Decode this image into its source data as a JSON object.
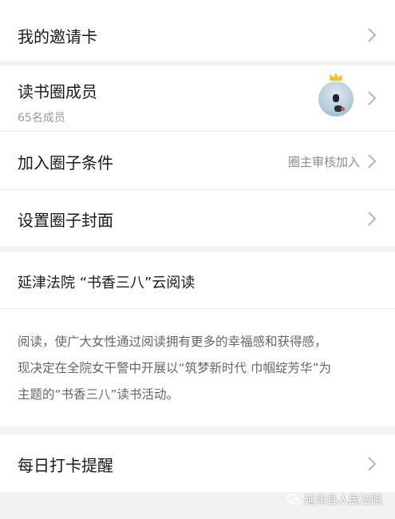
{
  "settings": {
    "invite_card": "我的邀请卡",
    "members": {
      "label": "读书圈成员",
      "count": "65名成员"
    },
    "join_condition": {
      "label": "加入圈子条件",
      "value": "圈主审核加入"
    },
    "cover": "设置圈子封面"
  },
  "topic": {
    "title": "延津法院 “书香三八”云阅读",
    "desc_line1": "阅读，使广大女性通过阅读拥有更多的幸福感和获得感，",
    "desc_line2": "现决定在全院女干警中开展以“筑梦新时代 巾帼绽芳华”为",
    "desc_line3": "主题的“书香三八”读书活动。"
  },
  "reminder": "每日打卡提醒",
  "watermark": "延津县人民法院",
  "colors": {
    "text": "#1a1a1a",
    "subtext": "#9a9a9a",
    "chevron": "#b5b5b5",
    "background": "#f2f2f2"
  },
  "icons": {
    "chevron": "chevron-right-icon",
    "crown": "crown-icon",
    "wechat": "wechat-icon"
  }
}
